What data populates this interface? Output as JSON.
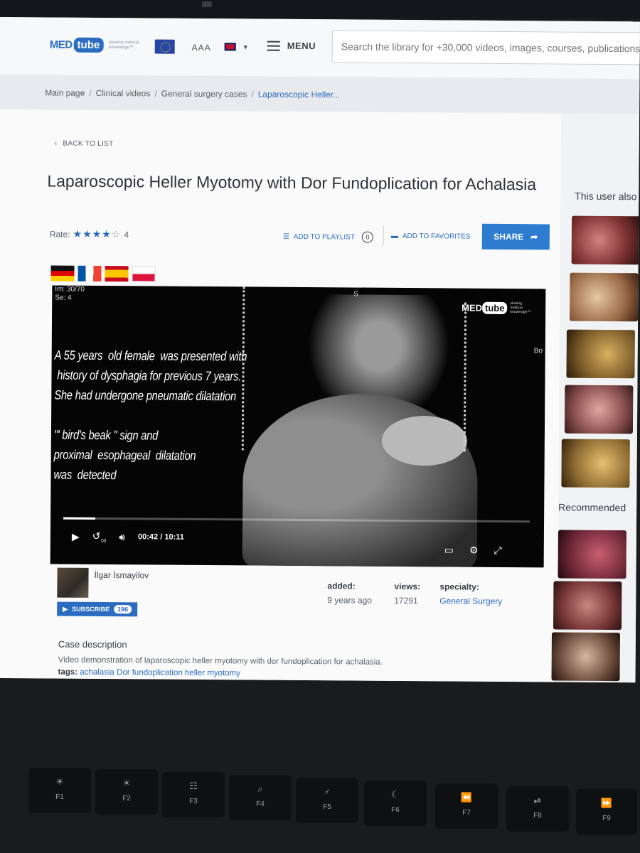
{
  "header": {
    "logo_med": "MED",
    "logo_tube": "tube",
    "logo_tagline": "sharing medical knowledge™",
    "font_size_label": "AAA",
    "menu_label": "MENU",
    "search_placeholder": "Search the library for +30,000 videos, images, courses, publications"
  },
  "breadcrumb": [
    "Main page",
    "Clinical videos",
    "General surgery cases",
    "Laparoscopic Heller..."
  ],
  "back_label": "BACK TO LIST",
  "title": "Laparoscopic Heller Myotomy with Dor Fundoplication for Achalasia",
  "rating": {
    "label": "Rate:",
    "value": "4",
    "stars": 4
  },
  "actions": {
    "playlist_label": "ADD TO PLAYLIST",
    "playlist_count": "0",
    "favorites_label": "ADD TO FAVORITES",
    "share_label": "SHARE"
  },
  "video": {
    "ct_info_1": "Im: 30/70",
    "ct_info_2": "Se: 4",
    "ct_s": "S",
    "ct_bo": "Bo",
    "caption": "A 55 years  old female  was presented with\n history of dysphagia for previous 7 years.\nShe had undergone pneumatic dilatation\n\n\"' bird's beak \" sign and\nproximal  esophageal  dilatation\nwas  detected",
    "current_time": "00:42",
    "time_sep": "/",
    "duration": "10:11",
    "progress": 0.069,
    "skip_label": "10"
  },
  "author": {
    "name": "İlgar İsmayilov",
    "subscribe_label": "SUBSCRIBE",
    "subscribers": "196"
  },
  "stats": {
    "added_label": "added:",
    "added_value": "9 years ago",
    "views_label": "views:",
    "views_value": "17291",
    "specialty_label": "specialty:",
    "specialty_value": "General Surgery"
  },
  "case": {
    "heading": "Case description",
    "text": "Video demonstration of laparoscopic heller myotomy with dor fundoplication for achalasia.",
    "tags_label": "tags:",
    "tags": "achalasia Dor fundoplication heller myotomy"
  },
  "sidebar": {
    "heading": "This user also",
    "recommended": "Recommended"
  },
  "keyboard": [
    {
      "glyph": "☀",
      "label": "F1"
    },
    {
      "glyph": "☀",
      "label": "F2"
    },
    {
      "glyph": "☷",
      "label": "F3"
    },
    {
      "glyph": "⌕",
      "label": "F4"
    },
    {
      "glyph": "♂",
      "label": "F5"
    },
    {
      "glyph": "☾",
      "label": "F6"
    },
    {
      "glyph": "⏪",
      "label": "F7"
    },
    {
      "glyph": "⏯",
      "label": "F8"
    },
    {
      "glyph": "⏩",
      "label": "F9"
    }
  ],
  "colors": {
    "brand": "#2b6cc0",
    "share": "#2d7cd0"
  }
}
